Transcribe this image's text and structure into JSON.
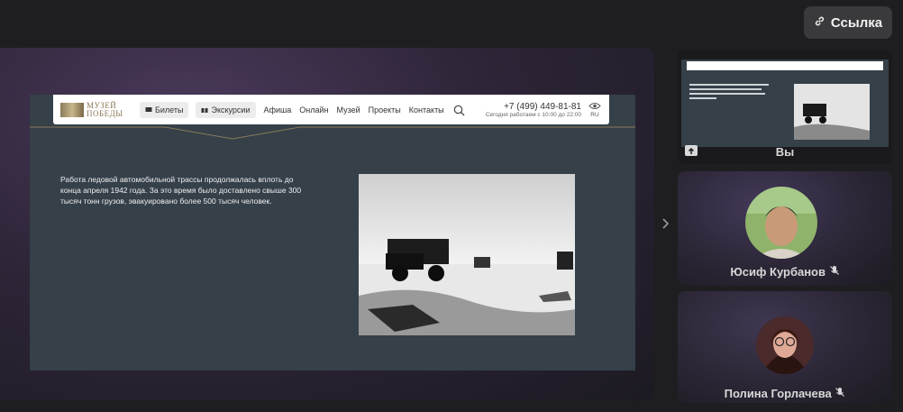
{
  "toolbar": {
    "link_label": "Ссылка",
    "link_icon": "link-icon"
  },
  "slide": {
    "nav": {
      "logo_line1": "МУЗЕЙ",
      "logo_line2": "ПОБЕДЫ",
      "tickets": "Билеты",
      "excursions": "Экскурсии",
      "links": [
        "Афиша",
        "Онлайн",
        "Музей",
        "Проекты",
        "Контакты"
      ],
      "phone": "+7 (499) 449-81-81",
      "hours": "Сегодня работаем с 10:00 до 22:00",
      "lang": "RU"
    },
    "text": "Работа ледовой автомобильной трассы продолжалась вплоть до конца апреля 1942 года. За это время было доставлено свыше 300 тысяч тонн грузов, эвакуировано более 500 тысяч человек."
  },
  "participants": [
    {
      "name": "Вы"
    },
    {
      "name": "Юсиф Курбанов",
      "mic": "mic-muted-icon"
    },
    {
      "name": "Полина Горлачева",
      "mic": "mic-muted-icon"
    }
  ]
}
